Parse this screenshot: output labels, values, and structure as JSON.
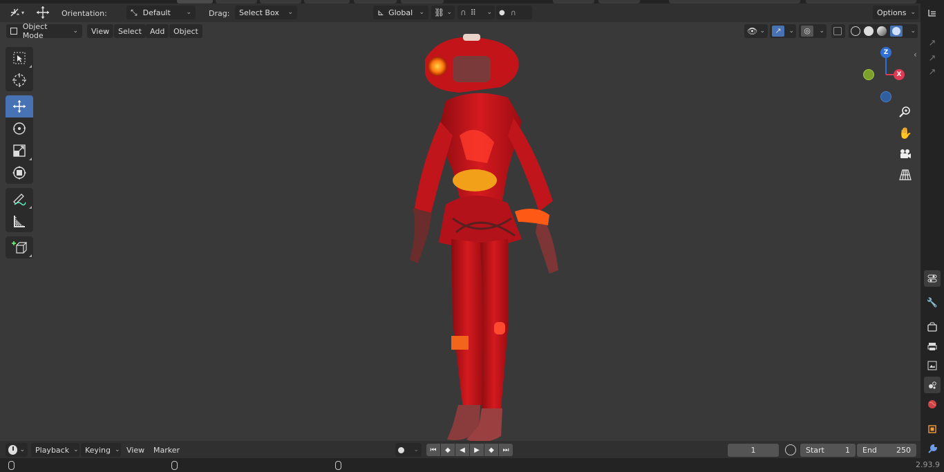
{
  "top_tabs": [
    "",
    "",
    "",
    "",
    "",
    "",
    "",
    "",
    ""
  ],
  "tool_header": {
    "editor_type_icon": "transform-tool-icon",
    "move_icon": "move-arrows-icon",
    "orientation_label": "Orientation:",
    "orientation_value": "Default",
    "drag_label": "Drag:",
    "drag_value": "Select Box",
    "pivot_value": "Global",
    "options_label": "Options"
  },
  "viewport_header": {
    "mode": "Object Mode",
    "menus": [
      "View",
      "Select",
      "Add",
      "Object"
    ]
  },
  "toolbar": {
    "tools": [
      "select-box-tool",
      "cursor-tool",
      "move-tool",
      "rotate-tool",
      "scale-tool",
      "transform-tool",
      "annotate-tool",
      "measure-tool",
      "add-cube-tool"
    ],
    "active": "move-tool"
  },
  "gizmo": {
    "z": "Z",
    "x": "X",
    "colors": {
      "z": "#2f6fd6",
      "x": "#e03a52",
      "y": "#7ba12a",
      "neg_y": "#7ba12a",
      "neg_z": "#2f5f9f"
    }
  },
  "timeline": {
    "menus": [
      "Playback",
      "Keying",
      "View",
      "Marker"
    ],
    "current_frame": "1",
    "start_label": "Start",
    "start_value": "1",
    "end_label": "End",
    "end_value": "250"
  },
  "status": {
    "version": "2.93.9"
  },
  "colors": {
    "accent": "#4772b3",
    "header_bg": "#303030",
    "viewport_bg": "#393939",
    "model_red": "#c8141c"
  }
}
